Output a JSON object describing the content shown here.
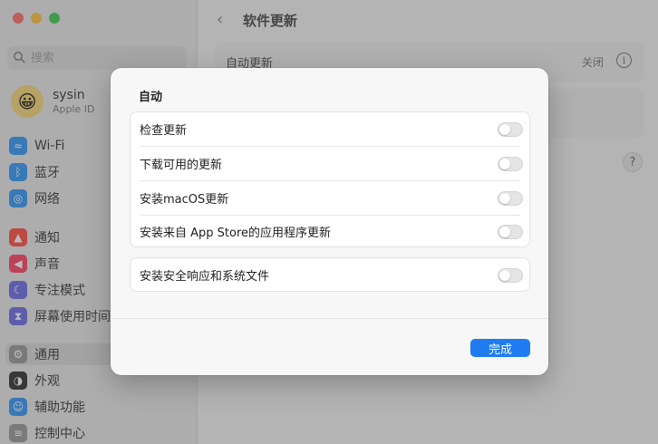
{
  "window": {
    "title": "软件更新",
    "search_placeholder": "搜索"
  },
  "account": {
    "name": "sysin",
    "subtitle": "Apple ID",
    "avatar_emoji": "😀"
  },
  "sidebar": {
    "items": [
      {
        "label": "Wi-Fi",
        "icon": "wifi-icon",
        "color": "#1d8cf8"
      },
      {
        "label": "蓝牙",
        "icon": "bluetooth-icon",
        "color": "#1d8cf8"
      },
      {
        "label": "网络",
        "icon": "globe-icon",
        "color": "#1d8cf8"
      },
      {
        "label": "通知",
        "icon": "bell-icon",
        "color": "#ff3b30"
      },
      {
        "label": "声音",
        "icon": "speaker-icon",
        "color": "#ff2d55"
      },
      {
        "label": "专注模式",
        "icon": "moon-icon",
        "color": "#5e5ce6"
      },
      {
        "label": "屏幕使用时间",
        "icon": "hourglass-icon",
        "color": "#5e5ce6"
      },
      {
        "label": "通用",
        "icon": "gear-icon",
        "color": "#8e8e93",
        "selected": true
      },
      {
        "label": "外观",
        "icon": "appearance-icon",
        "color": "#1c1c1e"
      },
      {
        "label": "辅助功能",
        "icon": "accessibility-icon",
        "color": "#1d8cf8"
      },
      {
        "label": "控制中心",
        "icon": "control-center-icon",
        "color": "#8e8e93"
      }
    ]
  },
  "main": {
    "auto_update_label": "自动更新",
    "auto_update_value": "关闭",
    "help": "?"
  },
  "sheet": {
    "title": "自动",
    "options": [
      {
        "label": "检查更新",
        "on": false
      },
      {
        "label": "下载可用的更新",
        "on": false
      },
      {
        "label": "安装macOS更新",
        "on": false
      },
      {
        "label": "安装来自 App Store的应用程序更新",
        "on": false
      }
    ],
    "security_option": {
      "label": "安装安全响应和系统文件",
      "on": false
    },
    "done_label": "完成"
  },
  "colors": {
    "accent": "#1f7cf0",
    "toggle_off": "#e5e5e5"
  }
}
